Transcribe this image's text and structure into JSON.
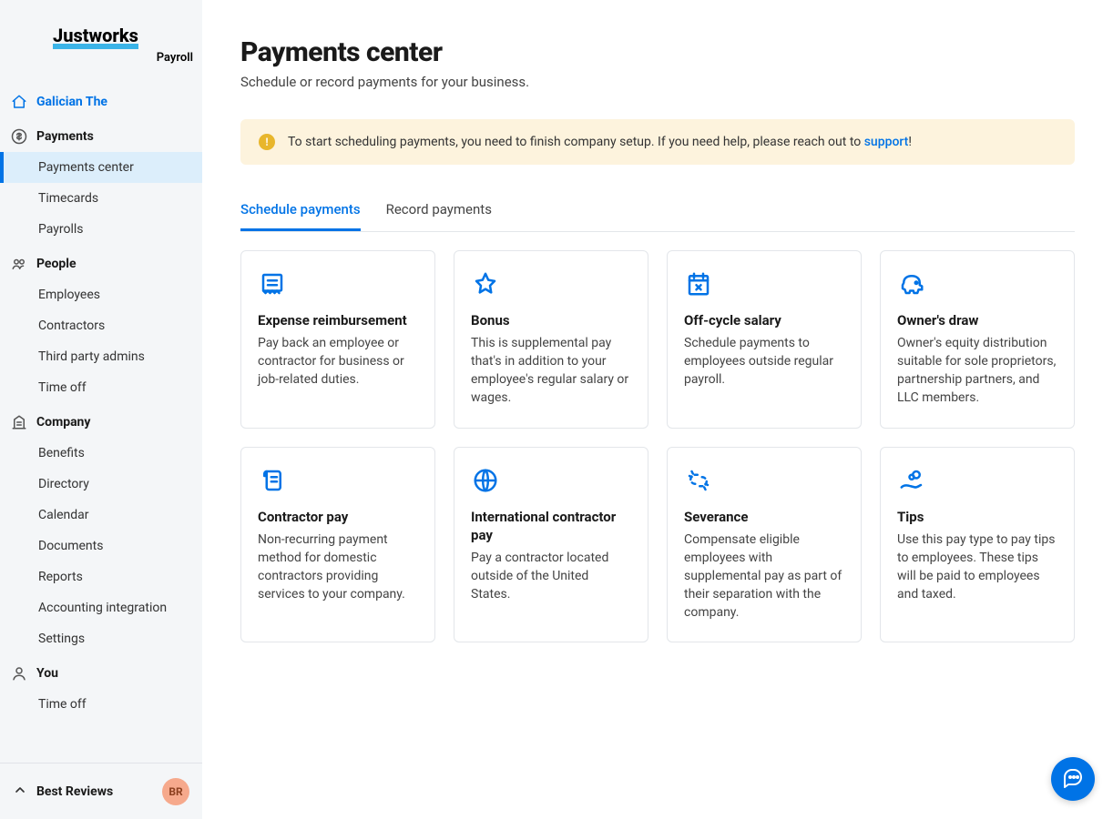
{
  "brand": {
    "name": "Justworks",
    "sub": "Payroll"
  },
  "sidebar": {
    "org": {
      "label": "Galician The"
    },
    "sections": [
      {
        "label": "Payments",
        "items": [
          {
            "label": "Payments center"
          },
          {
            "label": "Timecards"
          },
          {
            "label": "Payrolls"
          }
        ]
      },
      {
        "label": "People",
        "items": [
          {
            "label": "Employees"
          },
          {
            "label": "Contractors"
          },
          {
            "label": "Third party admins"
          },
          {
            "label": "Time off"
          }
        ]
      },
      {
        "label": "Company",
        "items": [
          {
            "label": "Benefits"
          },
          {
            "label": "Directory"
          },
          {
            "label": "Calendar"
          },
          {
            "label": "Documents"
          },
          {
            "label": "Reports"
          },
          {
            "label": "Accounting integration"
          },
          {
            "label": "Settings"
          }
        ]
      },
      {
        "label": "You",
        "items": [
          {
            "label": "Time off"
          }
        ]
      }
    ],
    "footer": {
      "label": "Best Reviews",
      "initials": "BR"
    }
  },
  "page": {
    "title": "Payments center",
    "subtitle": "Schedule or record payments for your business."
  },
  "alert": {
    "prefix": "To start scheduling payments, you need to finish company setup. If you need help, please reach out to ",
    "link": "support",
    "suffix": "!"
  },
  "tabs": [
    {
      "label": "Schedule payments"
    },
    {
      "label": "Record payments"
    }
  ],
  "cards": [
    {
      "title": "Expense reimbursement",
      "desc": "Pay back an employee or contractor for business or job-related duties.",
      "icon": "receipt"
    },
    {
      "title": "Bonus",
      "desc": "This is supplemental pay that's in addition to your employee's regular salary or wages.",
      "icon": "star"
    },
    {
      "title": "Off-cycle salary",
      "desc": "Schedule payments to employees outside regular payroll.",
      "icon": "calendar-x"
    },
    {
      "title": "Owner's draw",
      "desc": "Owner's equity distribution suitable for sole proprietors, partnership partners, and LLC members.",
      "icon": "piggy"
    },
    {
      "title": "Contractor pay",
      "desc": "Non-recurring payment method for domestic contractors providing services to your company.",
      "icon": "scroll"
    },
    {
      "title": "International contractor pay",
      "desc": "Pay a contractor located outside of the United States.",
      "icon": "globe"
    },
    {
      "title": "Severance",
      "desc": "Compensate eligible employees with supplemental pay as part of their separation with the company.",
      "icon": "unlink"
    },
    {
      "title": "Tips",
      "desc": "Use this pay type to pay tips to employees. These tips will be paid to employees and taxed.",
      "icon": "coins-hand"
    }
  ]
}
